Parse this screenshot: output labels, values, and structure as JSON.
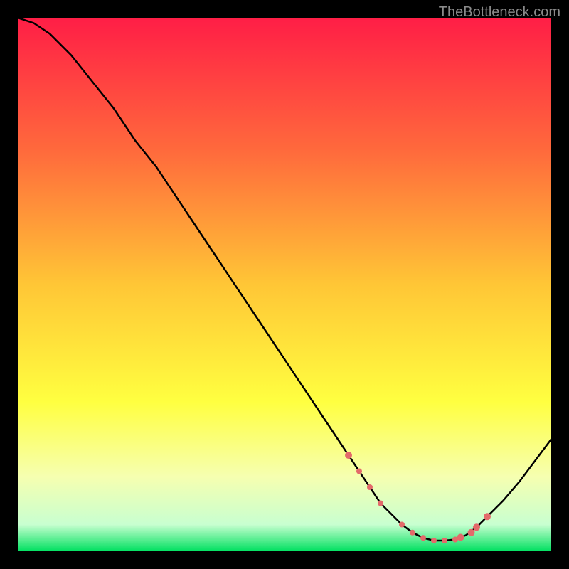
{
  "watermark": "TheBottleneck.com",
  "chart_data": {
    "type": "line",
    "title": "",
    "xlabel": "",
    "ylabel": "",
    "xlim": [
      0,
      100
    ],
    "ylim": [
      0,
      100
    ],
    "gradient_stops": [
      {
        "offset": 0,
        "color": "#ff1e46"
      },
      {
        "offset": 25,
        "color": "#ff6a3c"
      },
      {
        "offset": 50,
        "color": "#ffc636"
      },
      {
        "offset": 72,
        "color": "#ffff40"
      },
      {
        "offset": 86,
        "color": "#f6ffb0"
      },
      {
        "offset": 95,
        "color": "#c8ffd0"
      },
      {
        "offset": 100,
        "color": "#00e060"
      }
    ],
    "series": [
      {
        "name": "curve",
        "x": [
          0,
          3,
          6,
          10,
          14,
          18,
          22,
          26,
          30,
          34,
          38,
          42,
          46,
          50,
          54,
          58,
          62,
          64,
          66,
          68,
          70,
          72,
          74,
          76,
          78,
          80,
          82,
          84,
          86,
          88,
          91,
          94,
          97,
          100
        ],
        "y": [
          100,
          99,
          97,
          93,
          88,
          83,
          77,
          72,
          66,
          60,
          54,
          48,
          42,
          36,
          30,
          24,
          18,
          15,
          12,
          9,
          7,
          5,
          3.5,
          2.5,
          2,
          2,
          2.2,
          3,
          4.5,
          6.5,
          9.5,
          13,
          17,
          21
        ]
      }
    ],
    "markers": {
      "name": "highlight-points",
      "color": "#e36a6a",
      "x": [
        62,
        64,
        66,
        68,
        72,
        74,
        76,
        78,
        80,
        82,
        83,
        85,
        86,
        88
      ],
      "y": [
        18,
        15,
        12,
        9,
        5,
        3.5,
        2.5,
        2,
        2,
        2.2,
        2.6,
        3.5,
        4.5,
        6.5
      ],
      "r": [
        5,
        4,
        4,
        4,
        4,
        4,
        4,
        4,
        4,
        4,
        5,
        5,
        5,
        5
      ]
    }
  }
}
